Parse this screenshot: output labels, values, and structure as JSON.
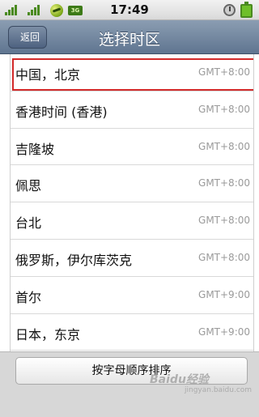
{
  "status_bar": {
    "time": "17:49",
    "badge": "3G",
    "icons": [
      "signal-icon",
      "signal-icon",
      "app-ball-icon",
      "battery-small-icon",
      "alarm-icon",
      "battery-icon"
    ]
  },
  "header": {
    "back_label": "返回",
    "title": "选择时区"
  },
  "timezones": [
    {
      "name": "中国，北京",
      "gmt": "GMT+8:00",
      "selected": true
    },
    {
      "name": "香港时间 (香港)",
      "gmt": "GMT+8:00",
      "selected": false
    },
    {
      "name": "吉隆坡",
      "gmt": "GMT+8:00",
      "selected": false
    },
    {
      "name": "佩思",
      "gmt": "GMT+8:00",
      "selected": false
    },
    {
      "name": "台北",
      "gmt": "GMT+8:00",
      "selected": false
    },
    {
      "name": "俄罗斯，伊尔库茨克",
      "gmt": "GMT+8:00",
      "selected": false
    },
    {
      "name": "首尔",
      "gmt": "GMT+9:00",
      "selected": false
    },
    {
      "name": "日本，东京",
      "gmt": "GMT+9:00",
      "selected": false
    }
  ],
  "footer": {
    "sort_label": "按字母顺序排序"
  },
  "watermark": {
    "text": "Baidu经验",
    "sub": "jingyan.baidu.com"
  },
  "colors": {
    "title_bar": "#6f84a0",
    "selection_border": "#d32a2a",
    "gmt_text": "#9a9a9a"
  }
}
